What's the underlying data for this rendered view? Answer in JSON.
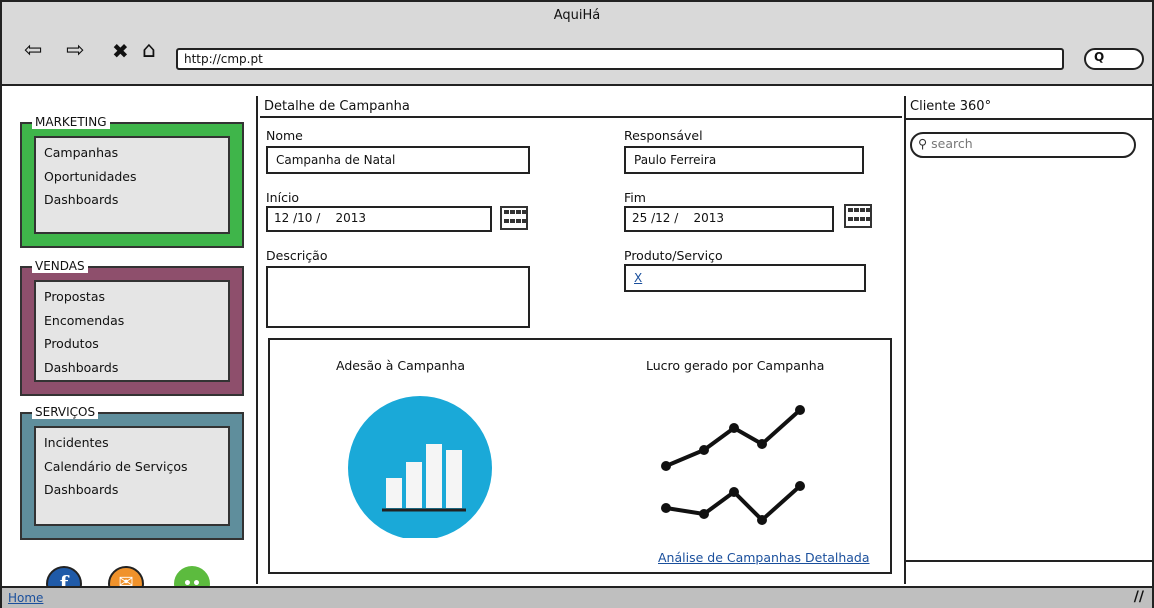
{
  "browser": {
    "title": "AquiHá",
    "url": "http://cmp.pt",
    "search_glyph": "Q",
    "back_glyph": "⇦",
    "forward_glyph": "⇨",
    "stop_glyph": "✖",
    "home_glyph": "⌂"
  },
  "sidebar": {
    "marketing": {
      "label": "MARKETING",
      "items": [
        "Campanhas",
        "Oportunidades",
        "Dashboards"
      ]
    },
    "vendas": {
      "label": "VENDAS",
      "items": [
        "Propostas",
        "Encomendas",
        "Produtos",
        "Dashboards"
      ]
    },
    "servicos": {
      "label": "SERVIÇOS",
      "items": [
        "Incidentes",
        "Calendário de Serviços",
        "Dashboards"
      ]
    },
    "social": {
      "facebook": "f",
      "mail": "✉",
      "chat": "••"
    }
  },
  "main": {
    "title": "Detalhe de Campanha",
    "nome": {
      "label": "Nome",
      "value": "Campanha de Natal"
    },
    "responsavel": {
      "label": "Responsável",
      "value": "Paulo Ferreira"
    },
    "inicio": {
      "label": "Início",
      "value": "12 /10 /    2013"
    },
    "fim": {
      "label": "Fim",
      "value": "25 /12 /    2013"
    },
    "descricao": {
      "label": "Descrição",
      "value": ""
    },
    "produto": {
      "label": "Produto/Serviço",
      "value": "X"
    },
    "charts": {
      "adesao_title": "Adesão à Campanha",
      "lucro_title": "Lucro gerado por Campanha",
      "link": "Análise de Campanhas Detalhada"
    }
  },
  "right": {
    "title": "Cliente 360°",
    "search_placeholder": "search"
  },
  "status": {
    "home": "Home"
  },
  "colors": {
    "marketing": "#3fb54a",
    "vendas": "#8e4f6c",
    "servicos": "#5f8e9c",
    "chart_circle": "#1aa9d8",
    "facebook": "#1f5aa8",
    "mail": "#f0922b",
    "chat": "#5cbb3e"
  }
}
